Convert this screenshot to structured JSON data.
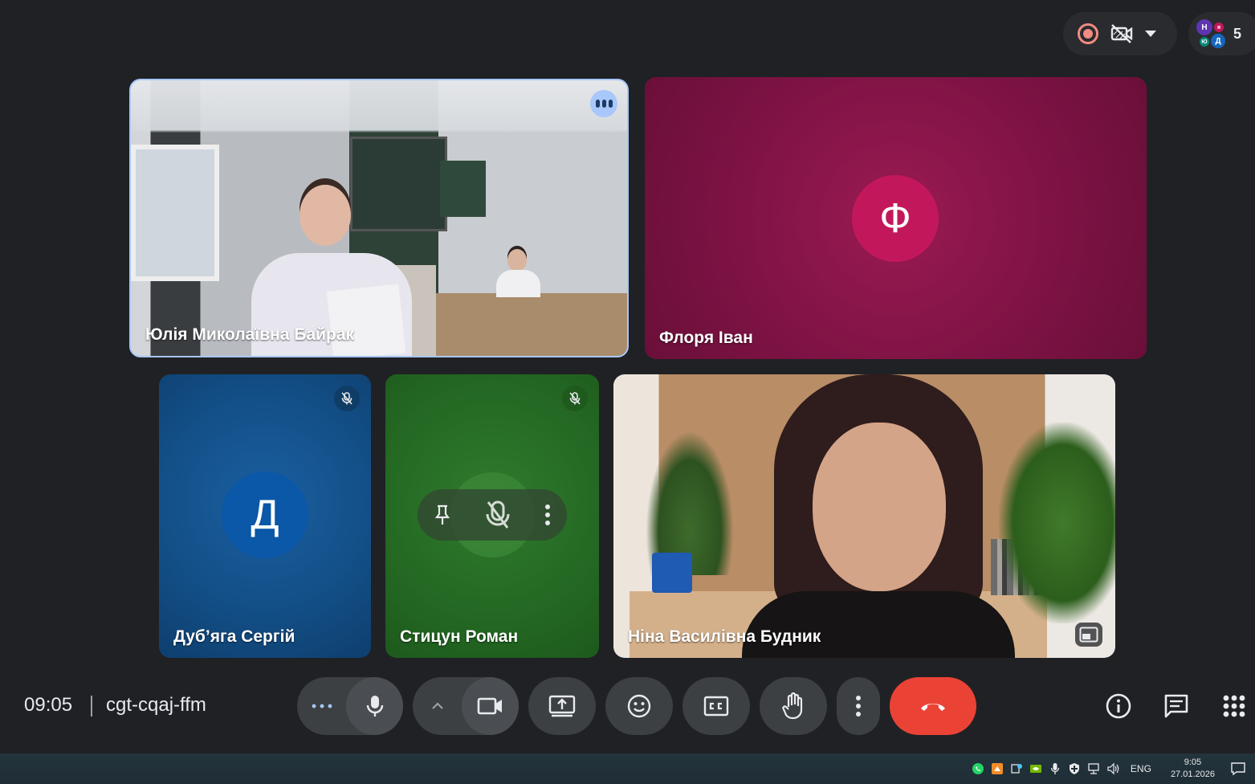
{
  "top_bar": {
    "participants_count": "5",
    "avatar_initials": [
      "Н",
      "я",
      "Ю",
      "Д"
    ]
  },
  "tiles": {
    "yulia": {
      "name": "Юлія Миколаївна Байрак"
    },
    "floria": {
      "name": "Флоря Іван",
      "initial": "Ф",
      "bg": "#7c1243",
      "avatar_color": "#c2185b"
    },
    "dubyaga": {
      "name": "Дуб’яга Сергій",
      "initial": "Д",
      "bg": "#134f88",
      "avatar_color": "#0b57a8",
      "muted": true
    },
    "stytsun": {
      "name": "Стицун Роман",
      "bg": "#256a24",
      "muted": true
    },
    "nina": {
      "name": "Ніна Василівна Будник"
    }
  },
  "bottom_bar": {
    "time": "09:05",
    "meeting_code": "cgt-cqaj-ffm"
  },
  "taskbar": {
    "lang": "ENG",
    "clock_time": "9:05",
    "clock_date": "27.01.2026"
  },
  "colors": {
    "background": "#202124",
    "leave_button": "#ea4335",
    "active_speaker_border": "#a8c7fa",
    "record_indicator": "#f28b82"
  }
}
